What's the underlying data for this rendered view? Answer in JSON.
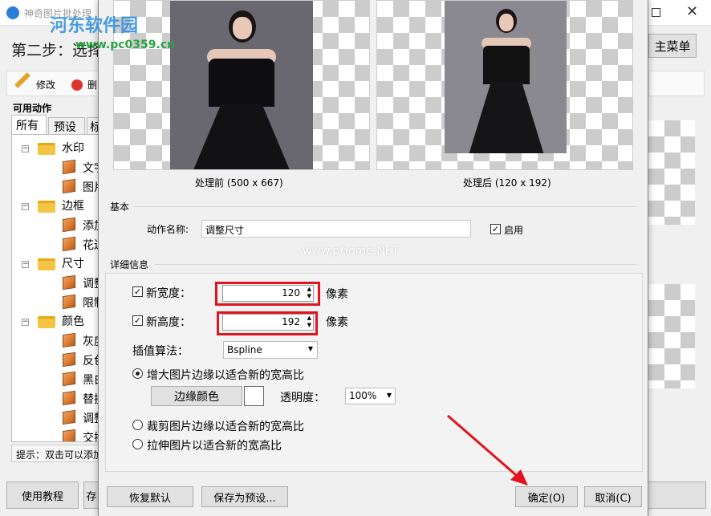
{
  "main_window": {
    "title": "神奇图片批处理",
    "step_text": "第二步：选择",
    "main_menu_button": "主菜单",
    "toolbar": {
      "edit_label": "修改",
      "delete_label": "删"
    },
    "available_actions_label": "可用动作",
    "tabs": [
      "所有",
      "预设",
      "标"
    ],
    "tree": [
      {
        "label": "水印",
        "children": [
          "文字",
          "图片"
        ]
      },
      {
        "label": "边框",
        "children": [
          "添加",
          "花边"
        ]
      },
      {
        "label": "尺寸",
        "children": [
          "调整",
          "限制"
        ]
      },
      {
        "label": "颜色",
        "children": [
          "灰度",
          "反色",
          "黑白",
          "替换",
          "调整",
          "交换"
        ]
      }
    ],
    "hint": "提示：双击可以添加",
    "tutorial_button": "使用教程",
    "bottom_btn_partial": "存"
  },
  "watermark": {
    "site_name": "河东软件园",
    "url": "www.pc0359.cn",
    "pic_watermark": "www.pHome.NET"
  },
  "dialog": {
    "before_caption": "处理前 (500 x 667)",
    "after_caption": "处理后 (120 x 192)",
    "basic_section": "基本",
    "action_name_label": "动作名称:",
    "action_name_value": "调整尺寸",
    "enable_label": "启用",
    "detail_section": "详细信息",
    "new_width_label": "新宽度：",
    "new_width_value": "120",
    "new_height_label": "新高度：",
    "new_height_value": "192",
    "unit_px": "像素",
    "interpolation_label": "插值算法：",
    "interpolation_value": "Bspline",
    "option_enlarge": "增大图片边缘以适合新的宽高比",
    "edge_color_button": "边缘颜色",
    "transparency_label": "透明度：",
    "transparency_value": "100%",
    "option_crop": "裁剪图片边缘以适合新的宽高比",
    "option_stretch": "拉伸图片以适合新的宽高比",
    "restore_default_button": "恢复默认",
    "save_preset_button": "保存为预设...",
    "ok_button": "确定(O)",
    "cancel_button": "取消(C)"
  },
  "colors": {
    "highlight_red": "#e0141e",
    "dialog_bg": "#f0f0f0",
    "photo_bg": "#696870"
  },
  "icons": [
    "app-icon",
    "pencil-icon",
    "delete-icon",
    "folder-icon",
    "box-icon",
    "checkbox-checked-icon",
    "spin-up-icon",
    "spin-down-icon",
    "dropdown-arrow-icon",
    "red-arrow-icon",
    "maximize-icon",
    "close-icon"
  ]
}
